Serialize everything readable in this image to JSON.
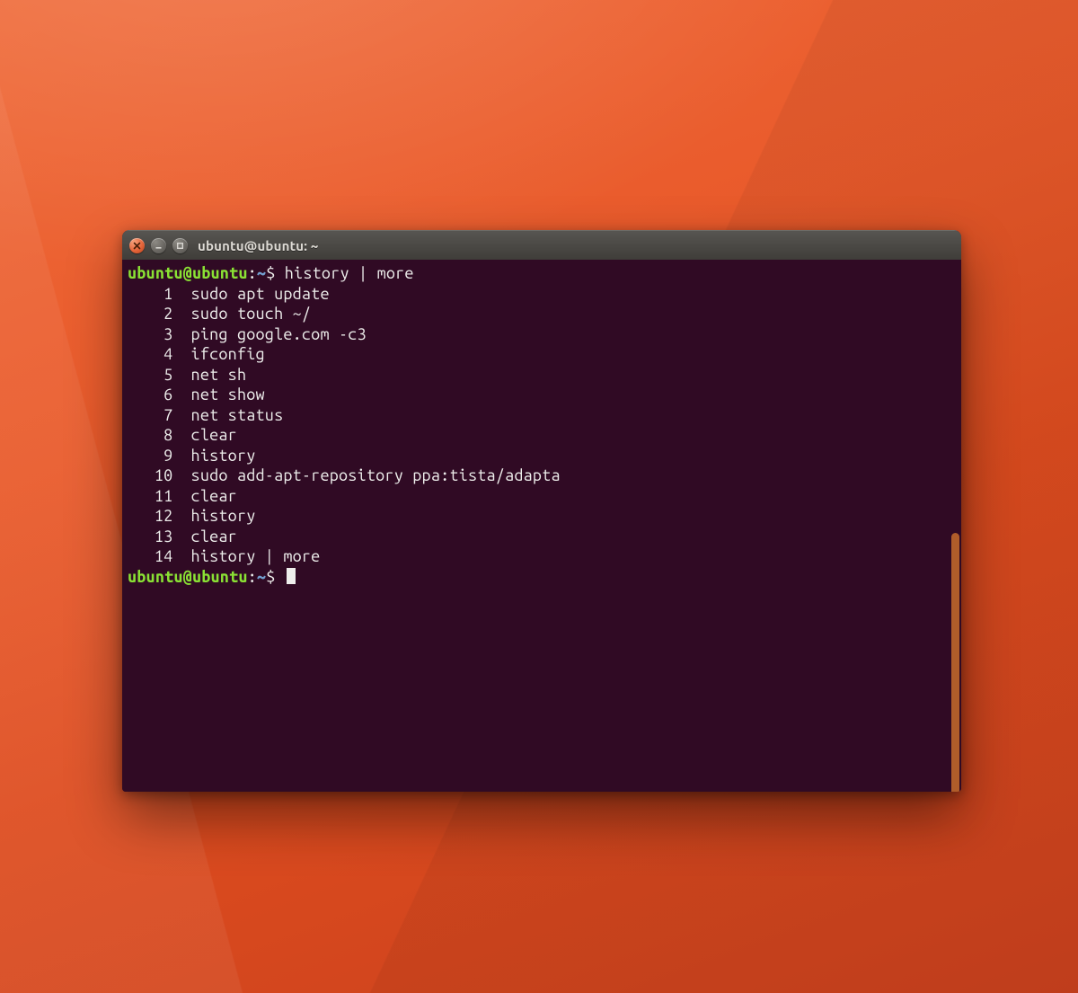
{
  "window": {
    "title": "ubuntu@ubuntu: ~"
  },
  "prompt": {
    "user_host": "ubuntu@ubuntu",
    "separator": ":",
    "path": "~",
    "symbol": "$"
  },
  "entered_command": "history | more",
  "history": [
    {
      "n": "1",
      "cmd": "sudo apt update"
    },
    {
      "n": "2",
      "cmd": "sudo touch ~/"
    },
    {
      "n": "3",
      "cmd": "ping google.com -c3"
    },
    {
      "n": "4",
      "cmd": "ifconfig"
    },
    {
      "n": "5",
      "cmd": "net sh"
    },
    {
      "n": "6",
      "cmd": "net show"
    },
    {
      "n": "7",
      "cmd": "net status"
    },
    {
      "n": "8",
      "cmd": "clear"
    },
    {
      "n": "9",
      "cmd": "history"
    },
    {
      "n": "10",
      "cmd": "sudo add-apt-repository ppa:tista/adapta"
    },
    {
      "n": "11",
      "cmd": "clear"
    },
    {
      "n": "12",
      "cmd": "history"
    },
    {
      "n": "13",
      "cmd": "clear"
    },
    {
      "n": "14",
      "cmd": "history | more"
    }
  ]
}
